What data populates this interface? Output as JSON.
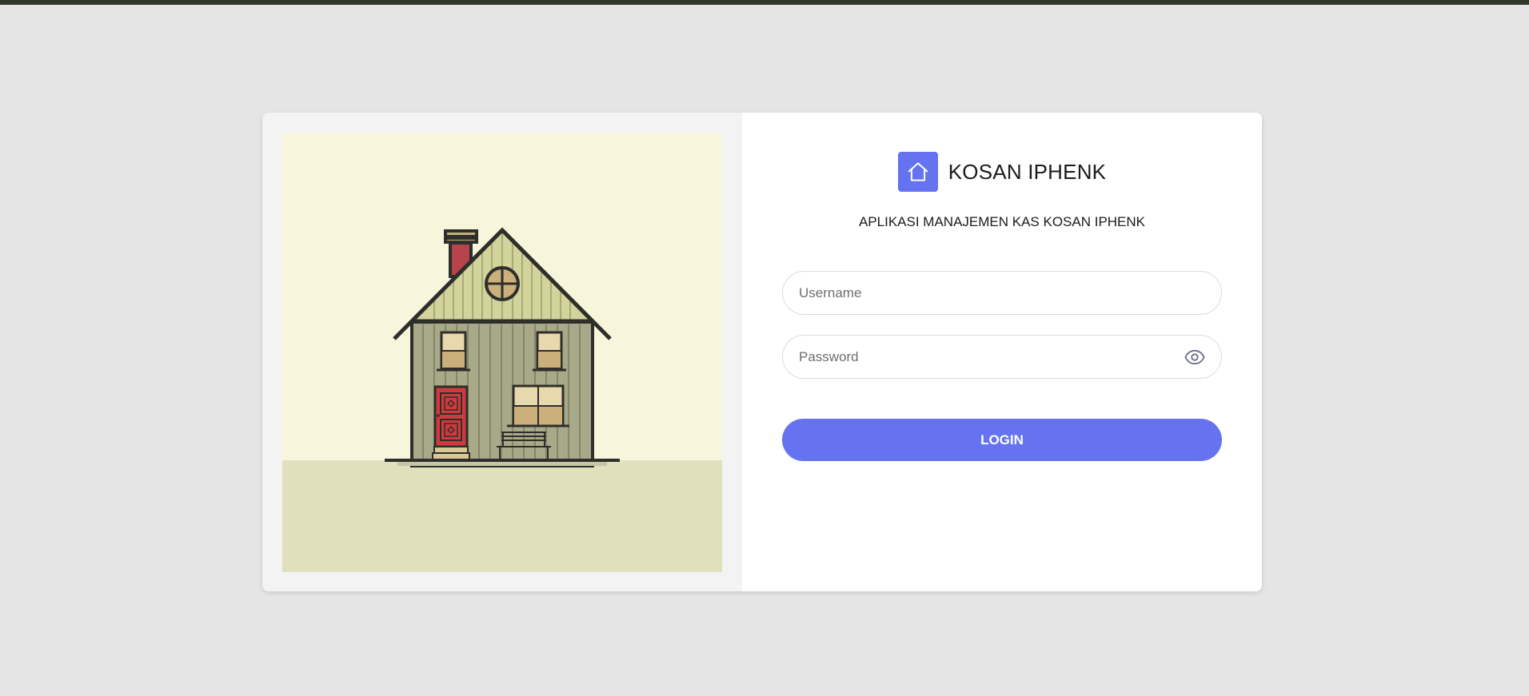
{
  "brand": {
    "name": "KOSAN IPHENK",
    "logo_icon": "home-icon",
    "accent_color": "#6573f0"
  },
  "subtitle": "APLIKASI MANAJEMEN KAS KOSAN IPHENK",
  "form": {
    "username": {
      "placeholder": "Username",
      "value": ""
    },
    "password": {
      "placeholder": "Password",
      "value": "",
      "toggle_icon": "eye-icon"
    },
    "login_label": "LOGIN"
  },
  "illustration": {
    "subject": "house-illustration"
  }
}
